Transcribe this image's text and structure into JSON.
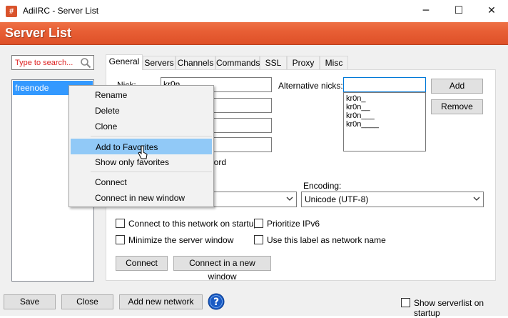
{
  "window": {
    "title": "AdiIRC - Server List",
    "app_icon_glyph": "#",
    "minimize_glyph": "─",
    "maximize_glyph": "☐",
    "close_glyph": "✕"
  },
  "header": {
    "title": "Server List"
  },
  "search": {
    "placeholder": "Type to search..."
  },
  "server_list": {
    "items": [
      "freenode"
    ]
  },
  "tabs": [
    {
      "label": "General",
      "active": true
    },
    {
      "label": "Servers"
    },
    {
      "label": "Channels"
    },
    {
      "label": "Commands"
    },
    {
      "label": "SSL"
    },
    {
      "label": "Proxy"
    },
    {
      "label": "Misc"
    }
  ],
  "general": {
    "nick_label": "Nick:",
    "nick_value": "kr0n",
    "alt_nicks_label": "Alternative nicks:",
    "alt_nick_input": "",
    "alt_nicks": [
      "kr0n_",
      "kr0n__",
      "kr0n___",
      "kr0n____"
    ],
    "add_button": "Add",
    "remove_button": "Remove",
    "password_suffix": "word",
    "encoding_label": "Encoding:",
    "encoding_value": "Unicode (UTF-8)",
    "options": [
      {
        "label": "Connect to this network on startup",
        "checked": false
      },
      {
        "label": "Prioritize IPv6",
        "checked": false
      },
      {
        "label": "Minimize the server window",
        "checked": false
      },
      {
        "label": "Use this label as network name",
        "checked": false
      }
    ],
    "connect_button": "Connect",
    "connect_new_window_button": "Connect in a new window"
  },
  "context_menu": {
    "items": [
      "Rename",
      "Delete",
      "Clone",
      "Add to Favorites",
      "Show only favorites",
      "Connect",
      "Connect in new window"
    ],
    "highlighted": "Add to Favorites"
  },
  "footer": {
    "save_button": "Save",
    "close_button": "Close",
    "add_network_button": "Add new network",
    "show_on_startup_label": "Show serverlist on startup",
    "show_on_startup_checked": false
  },
  "colors": {
    "header_accent": "#e85f35",
    "selection": "#3399ff",
    "menu_highlight": "#91c9f7",
    "help_icon": "#1a5bc4"
  }
}
